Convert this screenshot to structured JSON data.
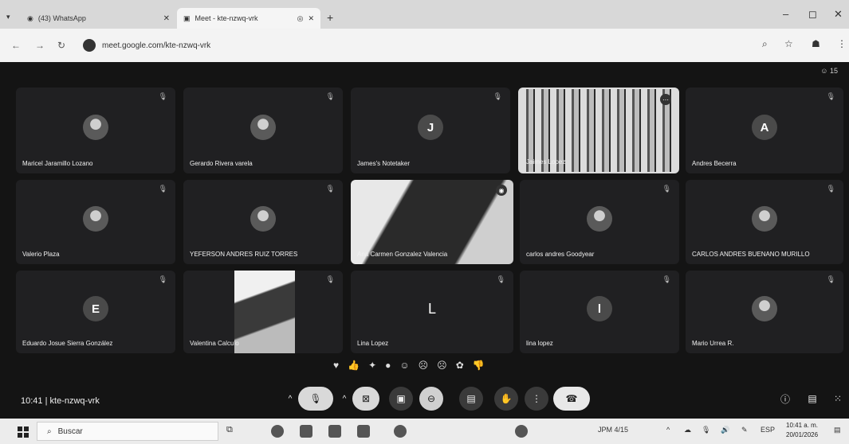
{
  "browser": {
    "tabs": [
      {
        "label": "(43) WhatsApp",
        "icon": "whatsapp-icon"
      },
      {
        "label": "Meet - kte-nzwq-vrk",
        "icon": "meet-icon"
      }
    ],
    "url": "meet.google.com/kte-nzwq-vrk"
  },
  "meet": {
    "participant_count": "15",
    "meeting_time": "10:41",
    "meeting_code": "kte-nzwq-vrk",
    "participants": [
      {
        "name": "Maricel Jaramillo Lozano"
      },
      {
        "name": "Gerardo Rivera varela"
      },
      {
        "name": "James's Notetaker",
        "initial": "J"
      },
      {
        "name": "Jaimes Lopez"
      },
      {
        "name": "Andres Becerra",
        "initial": "A"
      },
      {
        "name": "Valerio Plaza"
      },
      {
        "name": "YEFERSON ANDRES RUIZ TORRES"
      },
      {
        "name": "Ana Carmen Gonzalez Valencia"
      },
      {
        "name": "carlos andres Goodyear"
      },
      {
        "name": "CARLOS ANDRES BUENANO MURILLO"
      },
      {
        "name": "Eduardo Josue Sierra González",
        "initial": "E"
      },
      {
        "name": "Valentina Calculo"
      },
      {
        "name": "Lina Lopez",
        "initial": "L"
      },
      {
        "name": "lina lopez",
        "initial": "l"
      },
      {
        "name": "Mario Urrea R."
      }
    ]
  },
  "taskbar": {
    "search_placeholder": "Buscar",
    "weather": "JPM",
    "weather_detail": "4/15",
    "language": "ESP",
    "time": "10:41 a. m.",
    "date": "20/01/2026"
  },
  "colors": {
    "meet_background": "#141414",
    "tile_background": "#202022",
    "end_call": "#e8e8e8"
  }
}
